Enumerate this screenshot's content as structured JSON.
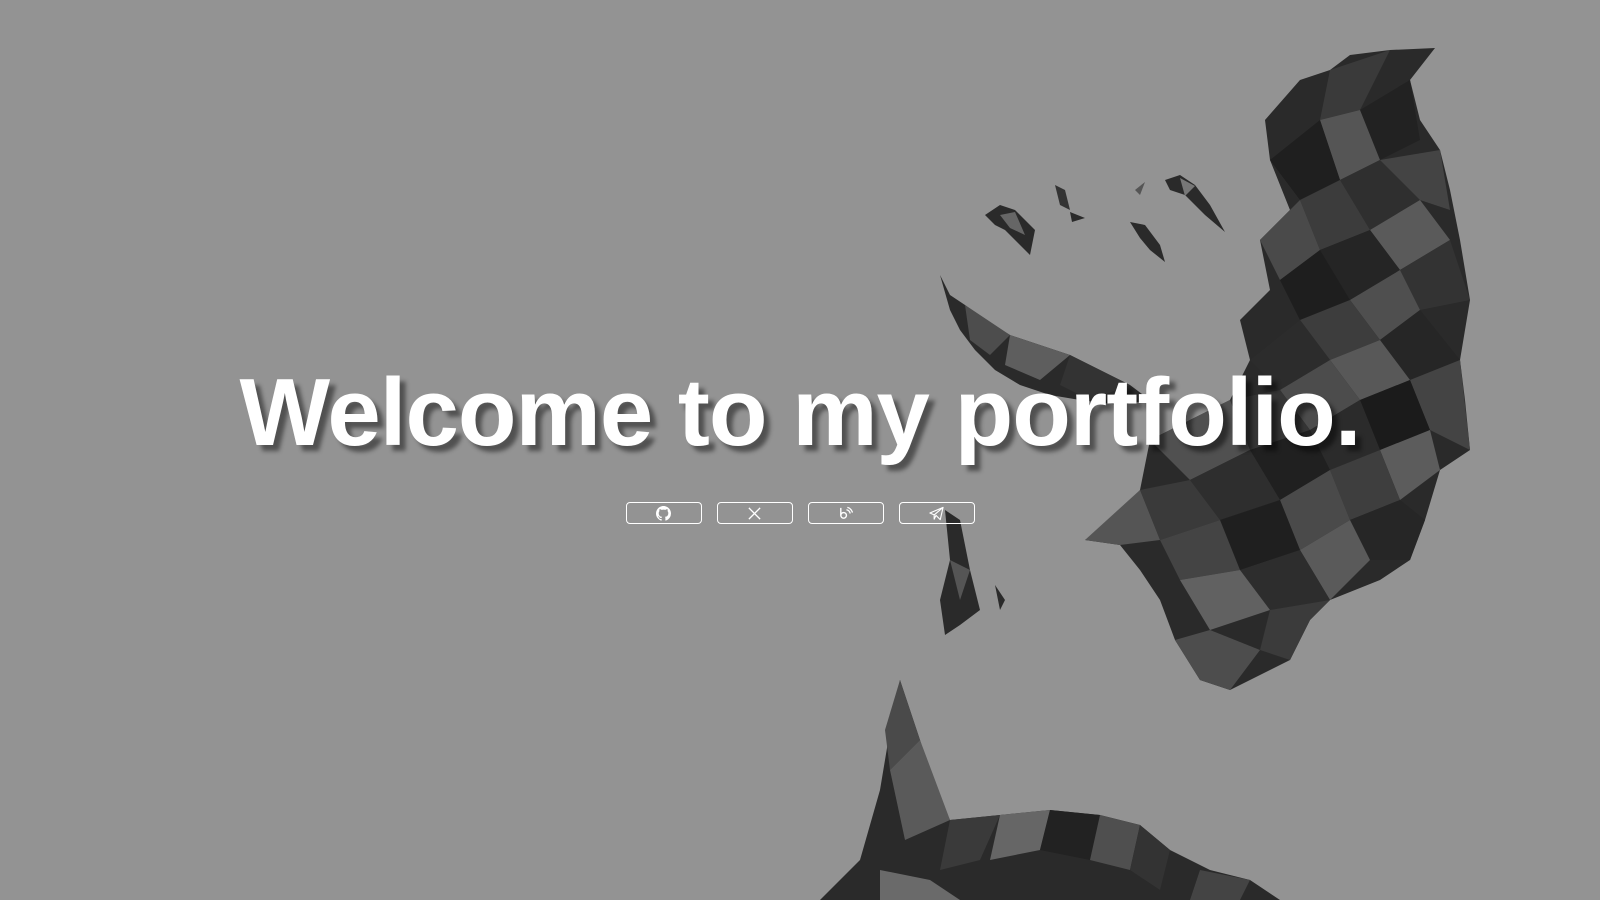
{
  "hero": {
    "headline": "Welcome to my portfolio."
  },
  "social_links": [
    {
      "icon": "github-icon"
    },
    {
      "icon": "x-icon"
    },
    {
      "icon": "blog-icon"
    },
    {
      "icon": "telegram-icon"
    }
  ],
  "colors": {
    "background": "#939393",
    "text": "#ffffff",
    "art_dark": "#232323",
    "art_mid": "#4a4a4a"
  }
}
